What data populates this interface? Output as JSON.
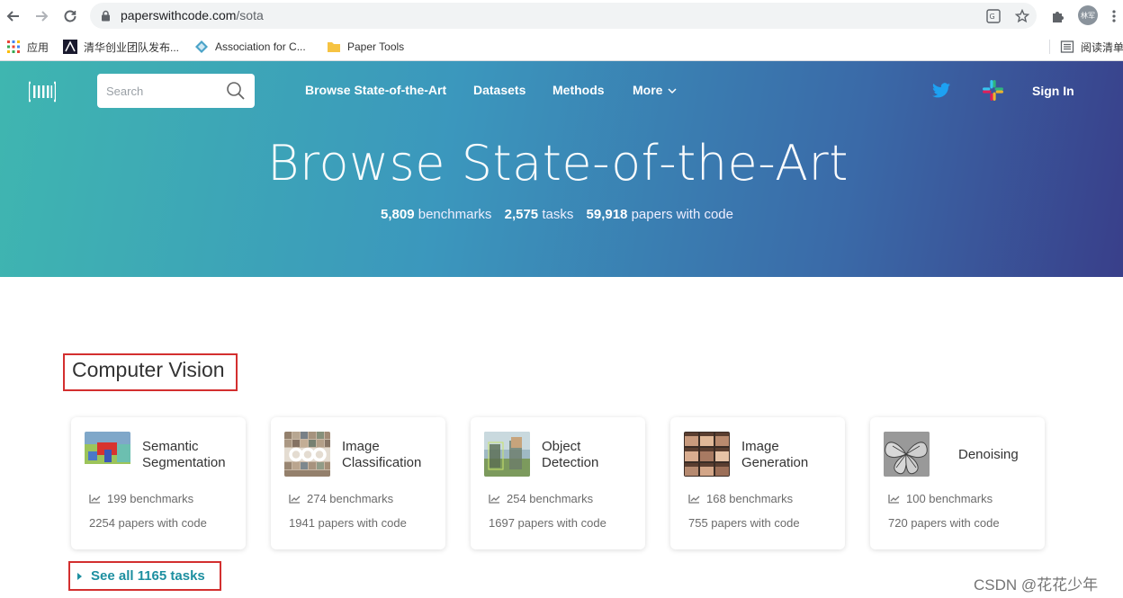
{
  "browser": {
    "url_host": "paperswithcode.com",
    "url_path": "/sota",
    "avatar_label": "林军",
    "bookmarks": [
      {
        "label": "应用"
      },
      {
        "label": "清华创业团队发布..."
      },
      {
        "label": "Association for C..."
      },
      {
        "label": "Paper Tools"
      },
      {
        "label": "阅读清单"
      }
    ]
  },
  "header": {
    "search_placeholder": "Search",
    "nav": [
      "Browse State-of-the-Art",
      "Datasets",
      "Methods",
      "More"
    ],
    "sign_in": "Sign In"
  },
  "hero": {
    "title": "Browse State-of-the-Art",
    "stats": [
      {
        "value": "5,809",
        "label": "benchmarks"
      },
      {
        "value": "2,575",
        "label": "tasks"
      },
      {
        "value": "59,918",
        "label": "papers with code"
      }
    ]
  },
  "section": {
    "title": "Computer Vision",
    "see_all": "See all 1165 tasks",
    "tasks": [
      {
        "name": "Semantic Segmentation",
        "benchmarks": "199 benchmarks",
        "papers": "2254 papers with code"
      },
      {
        "name": "Image Classification",
        "benchmarks": "274 benchmarks",
        "papers": "1941 papers with code"
      },
      {
        "name": "Object Detection",
        "benchmarks": "254 benchmarks",
        "papers": "1697 papers with code"
      },
      {
        "name": "Image Generation",
        "benchmarks": "168 benchmarks",
        "papers": "755 papers with code"
      },
      {
        "name": "Denoising",
        "benchmarks": "100 benchmarks",
        "papers": "720 papers with code"
      }
    ]
  },
  "watermark": "CSDN @花花少年",
  "colors": {
    "accent_teal": "#1d8fa0",
    "highlight_red": "#d32f2f",
    "twitter_blue": "#1da1f2"
  }
}
